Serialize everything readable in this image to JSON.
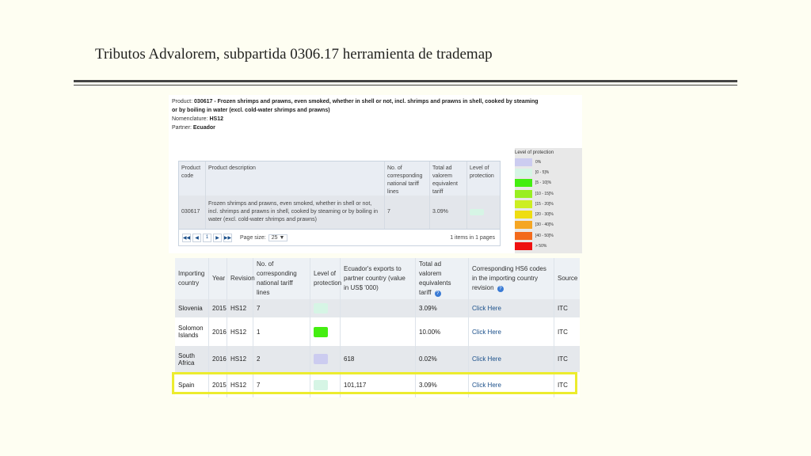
{
  "slide": {
    "title": "Tributos Advalorem, subpartida 0306.17 herramienta de trademap"
  },
  "info": {
    "product_label": "Product:",
    "product_code": "030617",
    "product_desc": " - Frozen shrimps and prawns, even smoked, whether in shell or not, incl. shrimps and prawns in shell, cooked by steaming or by boiling in water (excl. cold-water shrimps and prawns)",
    "nomenclature_label": "Nomenclature:",
    "nomenclature": "HS12",
    "partner_label": "Partner:",
    "partner": "Ecuador"
  },
  "product_table": {
    "headers": [
      "Product code",
      "Product description",
      "No. of corresponding national tariff lines",
      "Total ad valorem equivalent tariff",
      "Level of protection"
    ],
    "row": {
      "code": "030617",
      "description": "Frozen shrimps and prawns, even smoked, whether in shell or not, incl. shrimps and prawns in shell, cooked by steaming or by boiling in water (excl. cold-water shrimps and prawns)",
      "lines": "7",
      "tariff": "3.09%",
      "swatch": "#d6f5e5"
    },
    "pager": {
      "first": "◀◀",
      "prev": "◀",
      "page": "1",
      "next": "▶",
      "last": "▶▶",
      "size_label": "Page size:",
      "size_value": "25",
      "dropdown": "▼",
      "items_info": "1 items in 1 pages"
    }
  },
  "legend": {
    "title": "Level of protection",
    "items": [
      {
        "label": "0%",
        "color": "#ccccf0"
      },
      {
        "label": "]0 - 5]%",
        "color": "#d6f5e5"
      },
      {
        "label": "]5 - 10]%",
        "color": "#44ee11"
      },
      {
        "label": "]10 - 15]%",
        "color": "#99ee22"
      },
      {
        "label": "]15 - 20]%",
        "color": "#ccee22"
      },
      {
        "label": "]20 - 30]%",
        "color": "#eedd11"
      },
      {
        "label": "]30 - 40]%",
        "color": "#f5a623"
      },
      {
        "label": "]40 - 50]%",
        "color": "#f36a1c"
      },
      {
        "label": "> 50%",
        "color": "#ee1111"
      }
    ]
  },
  "main_table": {
    "headers": [
      "Importing country",
      "Year",
      "Revision",
      "No. of corresponding national tariff lines",
      "Level of protection",
      "Ecuador's exports to partner country (value in US$ '000)",
      "Total ad valorem equivalents tariff",
      "Corresponding HS6 codes in the importing country revision",
      "Source"
    ],
    "help_icon": "?",
    "rows": [
      {
        "country": "Slovenia",
        "year": "2015",
        "revision": "HS12",
        "lines": "7",
        "swatch": "#d6f5e5",
        "exports": "",
        "tariff": "3.09%",
        "link": "Click Here",
        "source": "ITC"
      },
      {
        "country": "Solomon Islands",
        "year": "2016",
        "revision": "HS12",
        "lines": "1",
        "swatch": "#44ee11",
        "exports": "",
        "tariff": "10.00%",
        "link": "Click Here",
        "source": "ITC"
      },
      {
        "country": "South Africa",
        "year": "2016",
        "revision": "HS12",
        "lines": "2",
        "swatch": "#ccccf0",
        "exports": "618",
        "tariff": "0.02%",
        "link": "Click Here",
        "source": "ITC"
      },
      {
        "country": "Spain",
        "year": "2015",
        "revision": "HS12",
        "lines": "7",
        "swatch": "#d6f5e5",
        "exports": "101,117",
        "tariff": "3.09%",
        "link": "Click Here",
        "source": "ITC"
      }
    ]
  }
}
